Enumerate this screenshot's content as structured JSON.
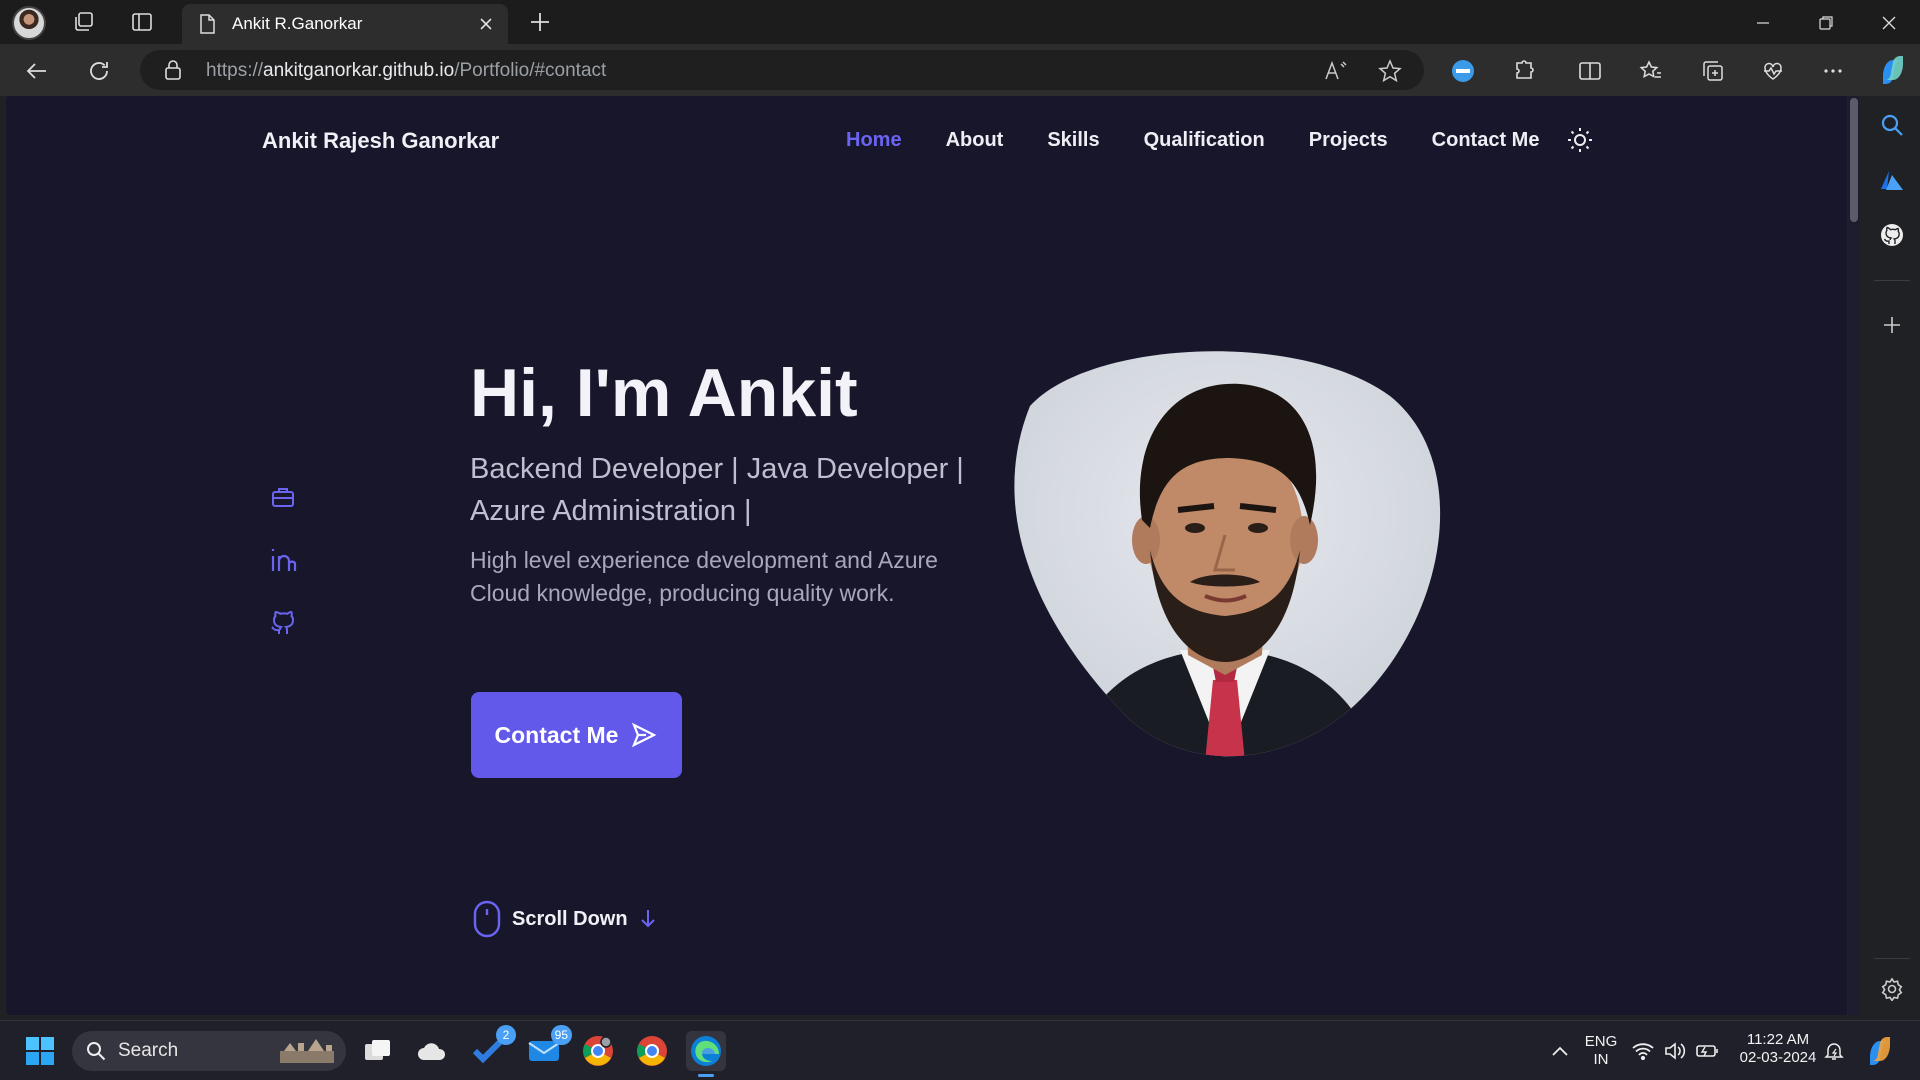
{
  "browser": {
    "tab_title": "Ankit R.Ganorkar",
    "url_prefix": "https://",
    "url_host": "ankitganorkar.github.io",
    "url_path": "/Portfolio/#contact"
  },
  "site": {
    "brand": "Ankit Rajesh Ganorkar",
    "nav": [
      {
        "label": "Home",
        "active": true
      },
      {
        "label": "About"
      },
      {
        "label": "Skills"
      },
      {
        "label": "Qualification"
      },
      {
        "label": "Projects"
      },
      {
        "label": "Contact Me"
      }
    ],
    "hero": {
      "title": "Hi, I'm Ankit",
      "subtitle": "Backend Developer | Java Developer | Azure Administration |",
      "description": "High level experience development and Azure Cloud knowledge, producing quality work.",
      "cta_label": "Contact Me"
    },
    "scroll_label": "Scroll Down",
    "accent_color": "#6259ea",
    "background_color": "#17162a"
  },
  "taskbar": {
    "search_placeholder": "Search",
    "todo_badge": "2",
    "mail_badge": "95",
    "lang_line1": "ENG",
    "lang_line2": "IN",
    "time": "11:22 AM",
    "date": "02-03-2024"
  }
}
